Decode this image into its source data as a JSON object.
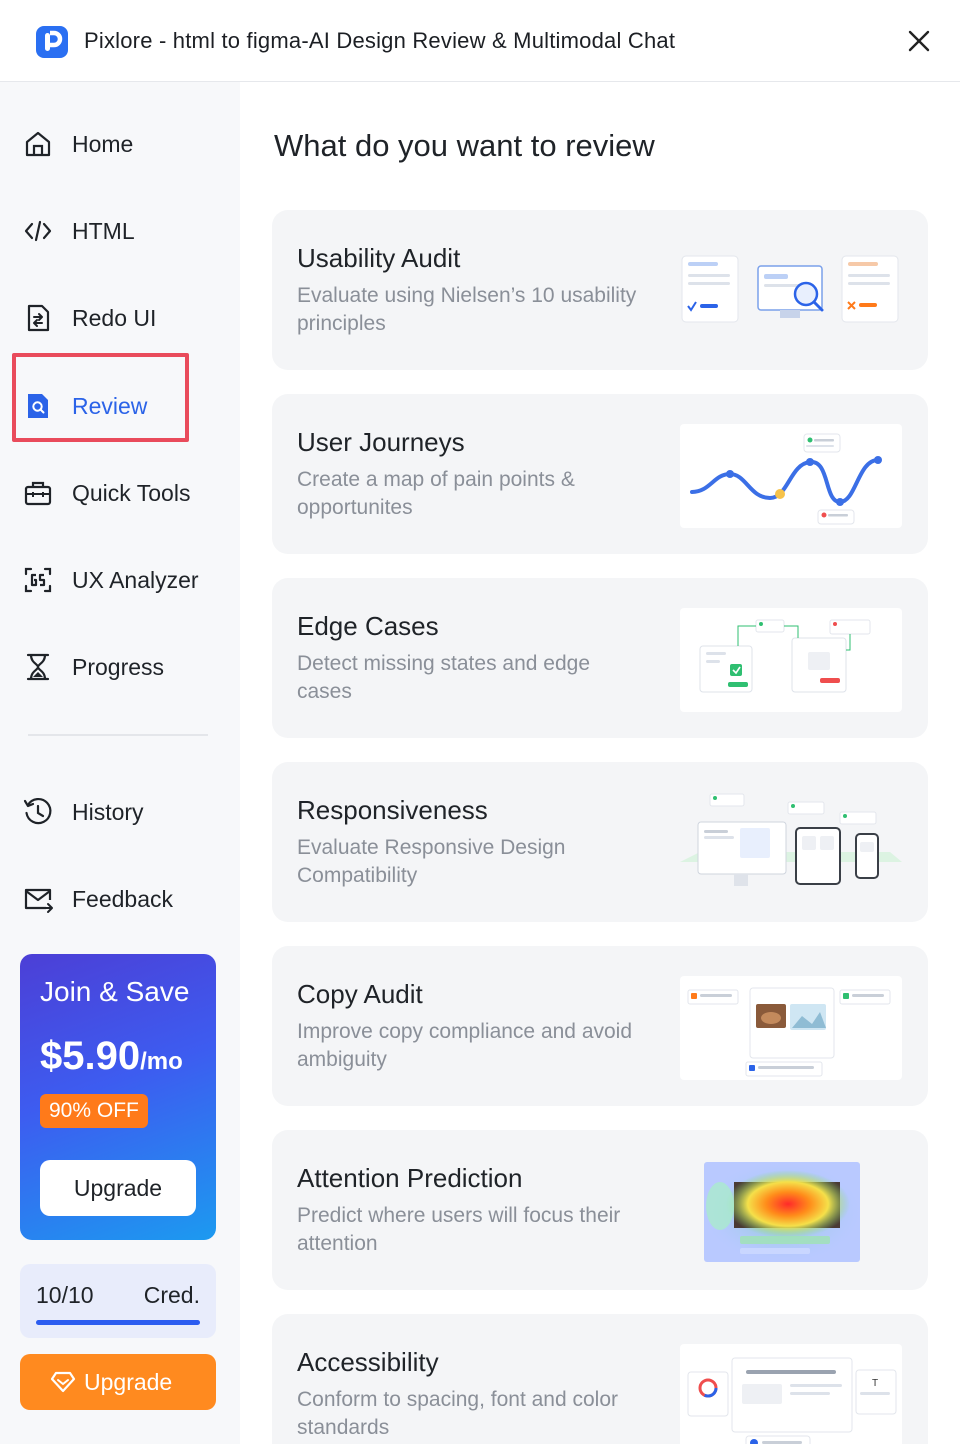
{
  "window": {
    "title": "Pixlore - html to figma-AI Design Review & Multimodal Chat",
    "close_icon": "close-icon",
    "logo_color": "#2a6ff2"
  },
  "sidebar": {
    "items": [
      {
        "label": "Home",
        "icon": "home-icon"
      },
      {
        "label": "HTML",
        "icon": "code-icon"
      },
      {
        "label": "Redo UI",
        "icon": "document-icon"
      },
      {
        "label": "Review",
        "icon": "review-icon",
        "active": true
      },
      {
        "label": "Quick Tools",
        "icon": "toolbox-icon"
      },
      {
        "label": "UX Analyzer",
        "icon": "analyzer-icon"
      },
      {
        "label": "Progress",
        "icon": "hourglass-icon"
      }
    ],
    "secondary_items": [
      {
        "label": "History",
        "icon": "history-icon"
      },
      {
        "label": "Feedback",
        "icon": "mail-icon"
      }
    ],
    "promo": {
      "title": "Join & Save",
      "price": "$5.90",
      "period": "/mo",
      "badge": "90% OFF",
      "button": "Upgrade"
    },
    "credits": {
      "count": "10/10",
      "label": "Cred.",
      "fraction": 1.0
    },
    "upgrade_button": "Upgrade",
    "accent_color": "#2b63e8",
    "upgrade_color": "#ff8a1f"
  },
  "main": {
    "heading": "What do you want to review",
    "cards": [
      {
        "title": "Usability Audit",
        "description": "Evaluate using Nielsen’s 10 usability principles",
        "illustration": "usability-audit-illustration"
      },
      {
        "title": "User Journeys",
        "description": "Create a map of pain points & opportunites",
        "illustration": "user-journey-illustration"
      },
      {
        "title": "Edge Cases",
        "description": "Detect missing states and edge cases",
        "illustration": "edge-cases-illustration"
      },
      {
        "title": "Responsiveness",
        "description": "Evaluate Responsive Design Compatibility",
        "illustration": "responsive-devices-illustration"
      },
      {
        "title": "Copy Audit",
        "description": "Improve copy compliance and avoid ambiguity",
        "illustration": "copy-audit-illustration"
      },
      {
        "title": "Attention Prediction",
        "description": "Predict where users will focus their attention",
        "illustration": "heatmap-illustration"
      },
      {
        "title": "Accessibility",
        "description": "Conform to spacing, font and color standards",
        "illustration": "accessibility-illustration"
      }
    ]
  }
}
